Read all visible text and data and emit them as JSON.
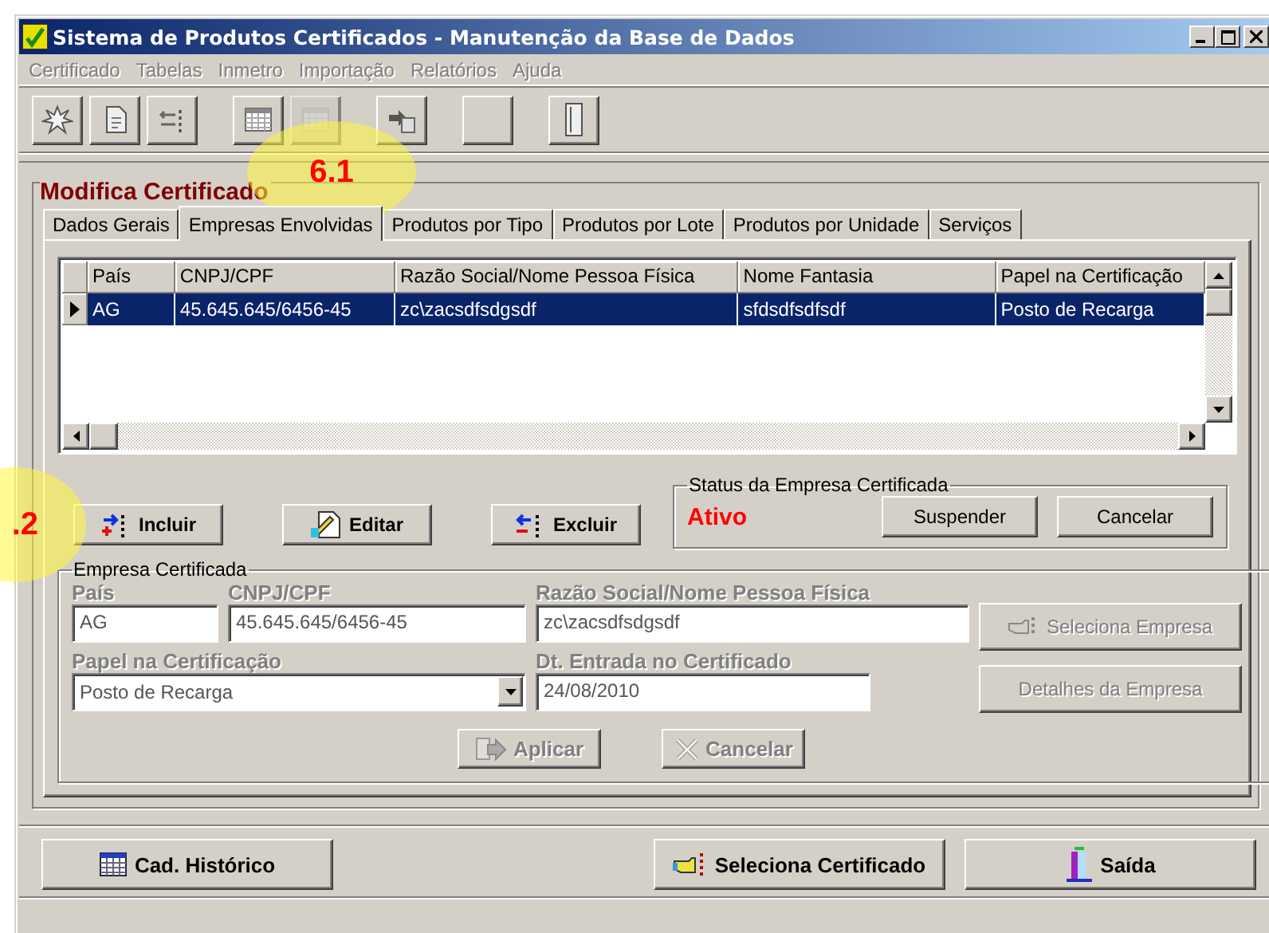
{
  "window": {
    "title": "Sistema de Produtos Certificados - Manutenção da Base de Dados"
  },
  "menu": [
    {
      "label": "Certificado",
      "disabled": true
    },
    {
      "label": "Tabelas",
      "disabled": true
    },
    {
      "label": "Inmetro",
      "disabled": true
    },
    {
      "label": "Importação",
      "disabled": true
    },
    {
      "label": "Relatórios",
      "disabled": true
    },
    {
      "label": "Ajuda",
      "disabled": true
    }
  ],
  "toolbar": [
    {
      "kind": "burst",
      "disabled": false
    },
    {
      "kind": "document",
      "disabled": false
    },
    {
      "kind": "arrows",
      "disabled": false
    },
    {
      "kind": "grid",
      "disabled": false
    },
    {
      "kind": "grid",
      "disabled": true
    },
    {
      "kind": "paste",
      "disabled": false
    },
    {
      "kind": "blank",
      "disabled": false
    },
    {
      "kind": "door",
      "disabled": false
    }
  ],
  "panel_title": "Modifica Certificado",
  "tabs": [
    {
      "label": "Dados Gerais",
      "selected": false
    },
    {
      "label": "Empresas Envolvidas",
      "selected": true
    },
    {
      "label": "Produtos por Tipo",
      "selected": false
    },
    {
      "label": "Produtos por Lote",
      "selected": false
    },
    {
      "label": "Produtos por Unidade",
      "selected": false
    },
    {
      "label": "Serviços",
      "selected": false
    }
  ],
  "table": {
    "columns": [
      "País",
      "CNPJ/CPF",
      "Razão Social/Nome Pessoa Física",
      "Nome Fantasia",
      "Papel na Certificação"
    ],
    "rows": [
      {
        "selected": true,
        "cells": [
          "AG",
          "45.645.645/6456-45",
          "zc\\zacsdfsdgsdf",
          "sfdsdfsdfsdf",
          "Posto de Recarga"
        ]
      }
    ]
  },
  "row_buttons": [
    {
      "kind": "add",
      "label": "Incluir"
    },
    {
      "kind": "edit",
      "label": "Editar"
    },
    {
      "kind": "remove",
      "label": "Excluir"
    }
  ],
  "status_group": {
    "title": "Status da Empresa Certificada",
    "status": "Ativo",
    "buttons": [
      {
        "label": "Suspender"
      },
      {
        "label": "Cancelar"
      }
    ]
  },
  "company_group": {
    "title": "Empresa Certificada",
    "pais": {
      "label": "País",
      "value": "AG"
    },
    "cnpj": {
      "label": "CNPJ/CPF",
      "value": "45.645.645/6456-45"
    },
    "razao": {
      "label": "Razão Social/Nome Pessoa Física",
      "value": "zc\\zacsdfsdgsdf"
    },
    "papel": {
      "label": "Papel na Certificação",
      "value": "Posto de Recarga"
    },
    "entrada": {
      "label": "Dt. Entrada no Certificado",
      "value": "24/08/2010"
    },
    "side_buttons": [
      {
        "kind": "hand",
        "label": "Seleciona Empresa",
        "disabled": true
      },
      {
        "kind": "plain",
        "label": "Detalhes da Empresa",
        "disabled": true
      }
    ],
    "action_buttons": [
      {
        "kind": "apply",
        "label": "Aplicar",
        "disabled": true
      },
      {
        "kind": "cancel",
        "label": "Cancelar",
        "disabled": true
      }
    ]
  },
  "bottom_buttons": [
    {
      "kind": "calendar",
      "label": "Cad. Histórico"
    },
    {
      "kind": "hand",
      "label": "Seleciona Certificado"
    },
    {
      "kind": "exit",
      "label": "Saída"
    }
  ],
  "callouts": [
    "6.1",
    ".2"
  ]
}
